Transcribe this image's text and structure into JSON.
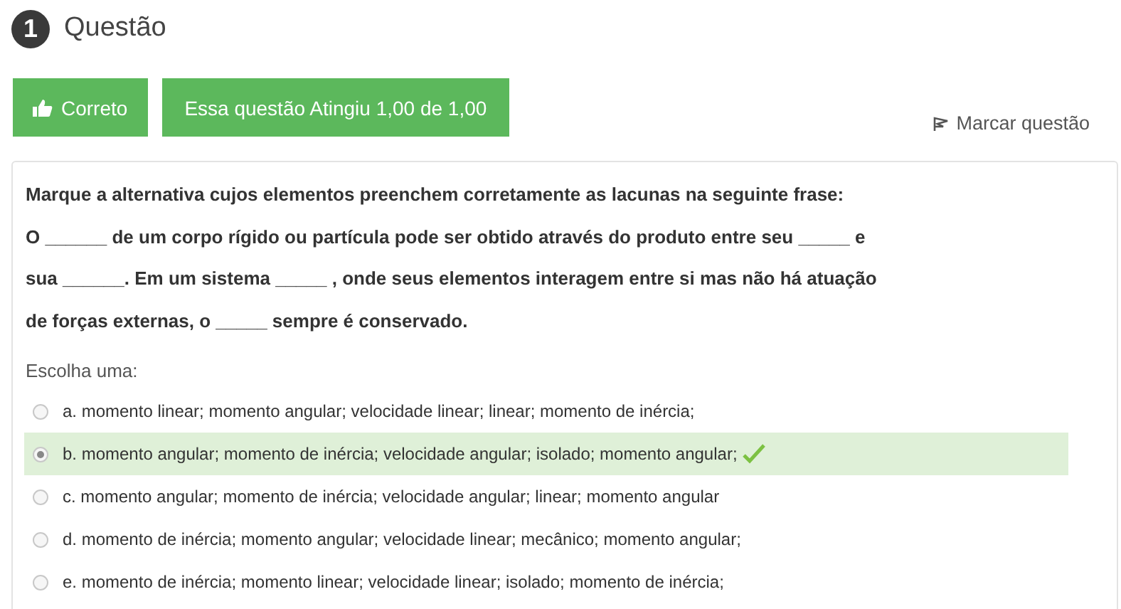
{
  "question": {
    "number": "1",
    "title": "Questão"
  },
  "buttons": [
    {
      "kind": "status",
      "label": "Correto"
    },
    {
      "kind": "grade",
      "label": "Essa questão Atingiu 1,00 de 1,00"
    }
  ],
  "flag": {
    "label": "Marcar questão"
  },
  "prompt": [
    "Marque a alternativa cujos elementos preenchem corretamente as lacunas na seguinte frase:",
    "O ______ de um corpo rígido ou partícula pode ser obtido através do produto entre seu _____ e",
    "sua ______. Em um sistema _____ , onde seus elementos interagem entre si mas não há atuação",
    "de forças externas, o _____ sempre é conservado."
  ],
  "choose_label": "Escolha uma:",
  "options": [
    {
      "label": "a. momento linear; momento angular; velocidade linear; linear; momento de inércia;",
      "selected": false,
      "correct": false
    },
    {
      "label": "b. momento angular; momento de inércia; velocidade angular; isolado; momento angular;",
      "selected": true,
      "correct": true
    },
    {
      "label": "c. momento angular; momento de inércia; velocidade angular; linear; momento angular",
      "selected": false,
      "correct": false
    },
    {
      "label": "d. momento de inércia; momento angular; velocidade linear; mecânico; momento angular;",
      "selected": false,
      "correct": false
    },
    {
      "label": "e. momento de inércia; momento linear; velocidade linear; isolado; momento de inércia;",
      "selected": false,
      "correct": false
    }
  ]
}
